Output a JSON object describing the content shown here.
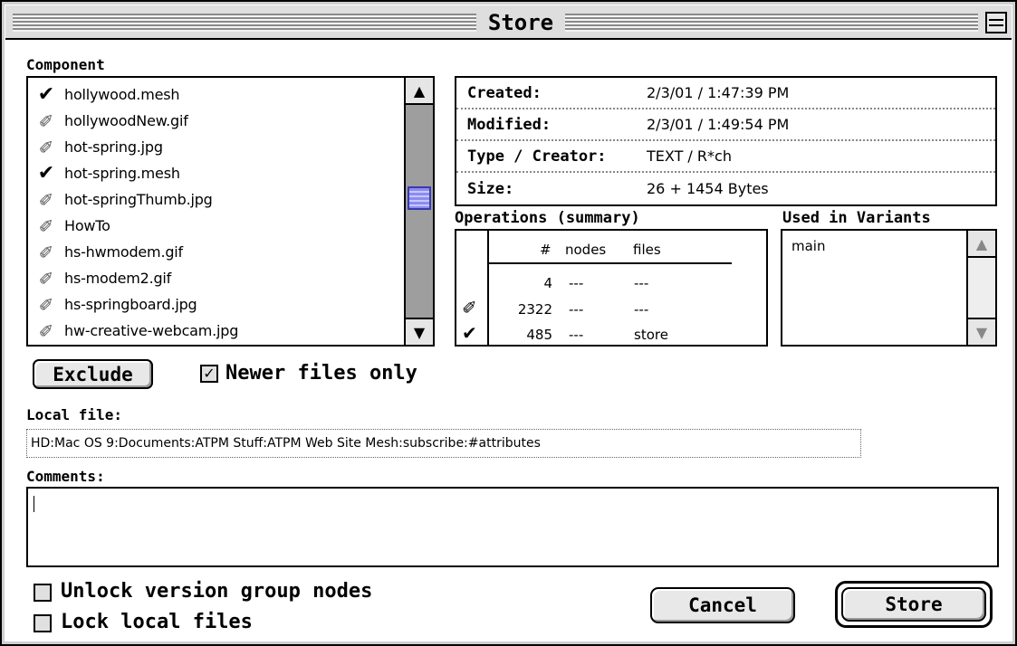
{
  "window": {
    "title": "Store"
  },
  "component": {
    "label": "Component",
    "items": [
      {
        "name": "hollywood.mesh",
        "checked": true
      },
      {
        "name": "hollywoodNew.gif",
        "checked": false
      },
      {
        "name": "hot-spring.jpg",
        "checked": false
      },
      {
        "name": "hot-spring.mesh",
        "checked": true
      },
      {
        "name": "hot-springThumb.jpg",
        "checked": false
      },
      {
        "name": "HowTo",
        "checked": false
      },
      {
        "name": "hs-hwmodem.gif",
        "checked": false
      },
      {
        "name": "hs-modem2.gif",
        "checked": false
      },
      {
        "name": "hs-springboard.jpg",
        "checked": false
      },
      {
        "name": "hw-creative-webcam.jpg",
        "checked": false
      }
    ]
  },
  "info": {
    "created_label": "Created:",
    "created_value": "2/3/01 / 1:47:39 PM",
    "modified_label": "Modified:",
    "modified_value": "2/3/01 / 1:49:54 PM",
    "type_label": "Type / Creator:",
    "type_value": "TEXT / R*ch",
    "size_label": "Size:",
    "size_value": "26 + 1454 Bytes"
  },
  "operations": {
    "label": "Operations (summary)",
    "headers": {
      "count": "#",
      "nodes": "nodes",
      "files": "files"
    },
    "rows": [
      {
        "mark": "",
        "count": "4",
        "nodes": "---",
        "files": "---"
      },
      {
        "mark": "✐",
        "count": "2322",
        "nodes": "---",
        "files": "---"
      },
      {
        "mark": "✔",
        "count": "485",
        "nodes": "---",
        "files": "store"
      }
    ]
  },
  "variants": {
    "label": "Used in Variants",
    "items": [
      "main"
    ]
  },
  "exclude_button": "Exclude",
  "newer_only": {
    "label": "Newer files only",
    "checked": true
  },
  "local_file": {
    "label": "Local file:",
    "value": "HD:Mac OS 9:Documents:ATPM Stuff:ATPM Web Site Mesh:subscribe:#attributes"
  },
  "comments": {
    "label": "Comments:",
    "value": ""
  },
  "unlock_version": {
    "label": "Unlock version group nodes",
    "checked": false
  },
  "lock_local": {
    "label": "Lock local files",
    "checked": false
  },
  "cancel_button": "Cancel",
  "store_button": "Store",
  "icons": {
    "checked": "heavy-check-mark",
    "unchecked": "pencil-check-outline"
  }
}
